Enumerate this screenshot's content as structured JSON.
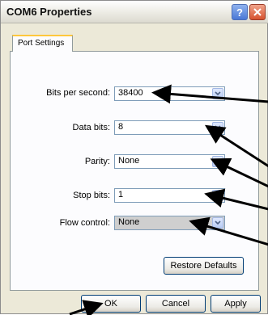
{
  "window": {
    "title": "COM6 Properties",
    "help_icon": "question-mark-icon",
    "close_icon": "close-icon"
  },
  "tabs": [
    {
      "label": "Port Settings"
    }
  ],
  "settings": {
    "bits_per_second": {
      "label": "Bits per second:",
      "value": "38400"
    },
    "data_bits": {
      "label": "Data bits:",
      "value": "8"
    },
    "parity": {
      "label": "Parity:",
      "value": "None"
    },
    "stop_bits": {
      "label": "Stop bits:",
      "value": "1"
    },
    "flow_control": {
      "label": "Flow control:",
      "value": "None"
    }
  },
  "buttons": {
    "restore_defaults": "Restore Defaults",
    "ok": "OK",
    "cancel": "Cancel",
    "apply": "Apply"
  },
  "colors": {
    "dialog_bg": "#ece9d8",
    "panel_bg": "#fcfcfe",
    "tab_highlight": "#ffc73c"
  }
}
